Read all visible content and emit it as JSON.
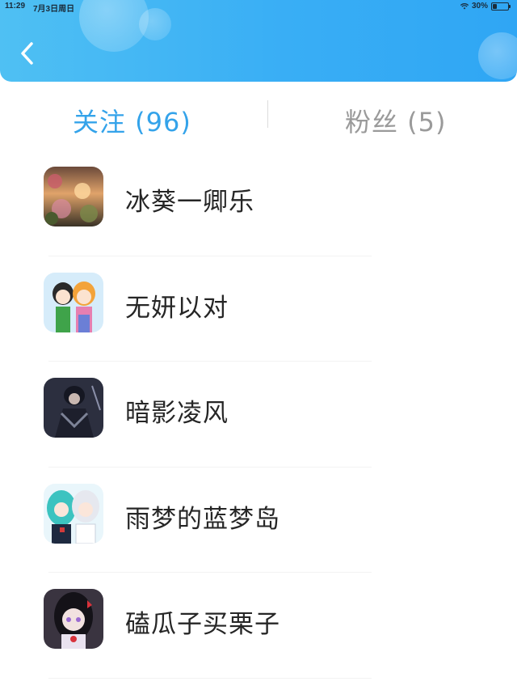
{
  "status_bar": {
    "time": "11:29",
    "date": "7月3日周日",
    "battery": "30%",
    "battery_level": 0.3,
    "icons": [
      "wifi-icon",
      "battery-icon"
    ]
  },
  "header": {
    "back_icon": "chevron-left-icon",
    "color_start": "#4fc0f3",
    "color_end": "#2fa6f4"
  },
  "tabs": [
    {
      "label": "关注 (96)",
      "active": true,
      "color": "#34a3ea"
    },
    {
      "label": "粉丝 (5)",
      "active": false,
      "color": "#9a9a9a"
    }
  ],
  "following": [
    {
      "name": "冰葵一卿乐",
      "avatar": "avatar-flowers-sunset"
    },
    {
      "name": "无妍以对",
      "avatar": "avatar-anime-couple"
    },
    {
      "name": "暗影凌风",
      "avatar": "avatar-dark-armored-figure"
    },
    {
      "name": "雨梦的蓝梦岛",
      "avatar": "avatar-anime-girls-teal"
    },
    {
      "name": "磕瓜子买栗子",
      "avatar": "avatar-anime-dark-hair"
    }
  ]
}
